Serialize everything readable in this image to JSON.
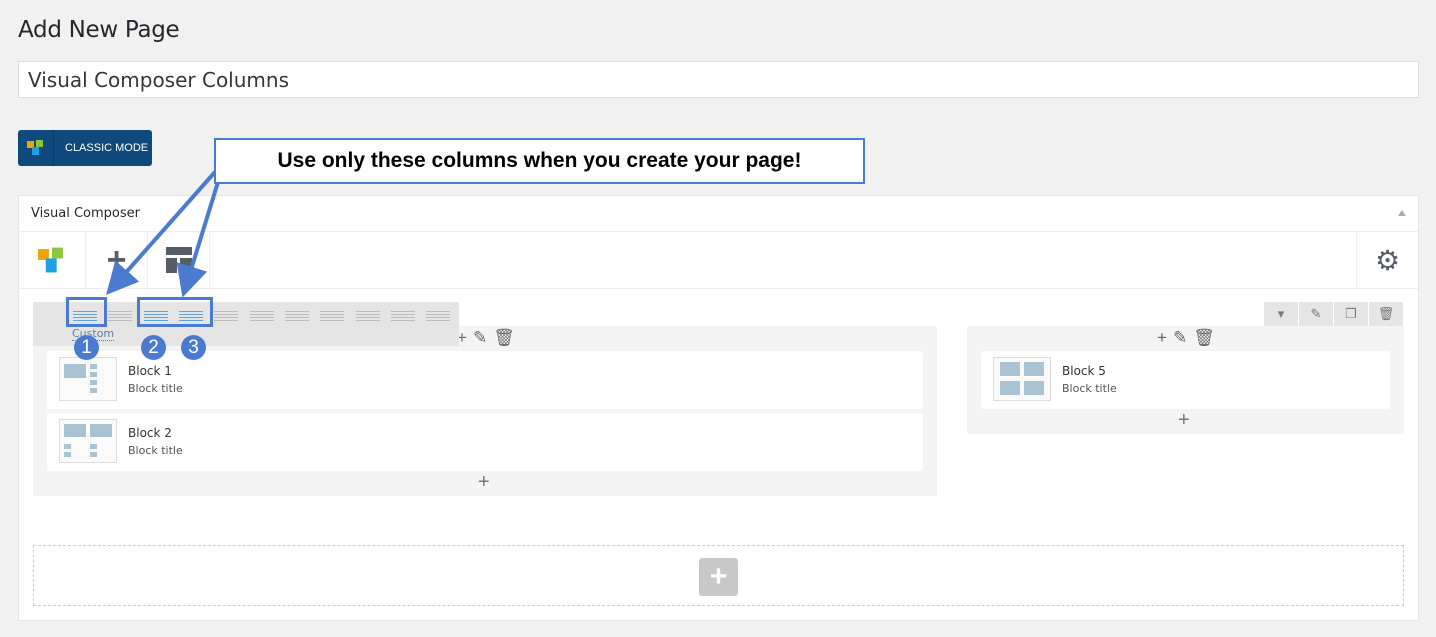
{
  "page": {
    "title": "Add New Page",
    "title_value": "Visual Composer Columns"
  },
  "classic_mode": {
    "label": "CLASSIC MODE"
  },
  "callout": {
    "text": "Use only these columns when you create your page!",
    "numbers": [
      "1",
      "2",
      "3"
    ],
    "color": "#4a7bd0"
  },
  "panel": {
    "title": "Visual Composer"
  },
  "row": {
    "layout_custom_label": "Custom",
    "left_blocks": [
      {
        "title": "Block 1",
        "subtitle": "Block title"
      },
      {
        "title": "Block 2",
        "subtitle": "Block title"
      }
    ],
    "right_blocks": [
      {
        "title": "Block 5",
        "subtitle": "Block title"
      }
    ]
  },
  "icons": [
    "move-icon",
    "plus-icon",
    "pencil-icon",
    "trash-icon",
    "clone-icon",
    "gear-icon",
    "layout-icon",
    "caret-down-icon"
  ],
  "add_element": {
    "label": "+"
  }
}
